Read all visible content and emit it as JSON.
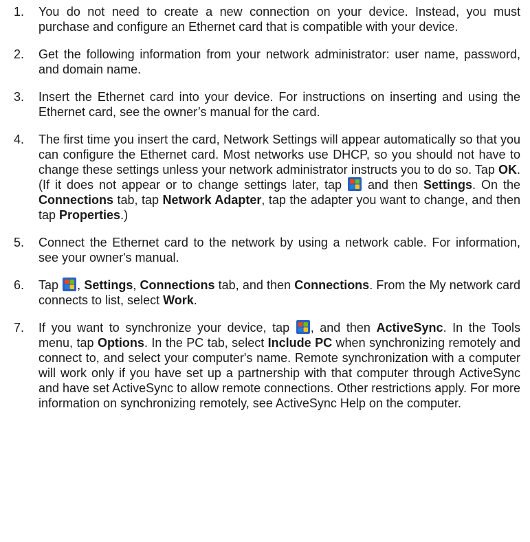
{
  "steps": [
    {
      "num": "1.",
      "parts": [
        {
          "t": "You do not need to create a new connection on your device. Instead, you must purchase and configure an Ethernet card that is compatible with your device."
        }
      ]
    },
    {
      "num": "2.",
      "parts": [
        {
          "t": "Get the following information from your network administrator: user name, password, and domain name."
        }
      ]
    },
    {
      "num": "3.",
      "parts": [
        {
          "t": "Insert the Ethernet card into your device. For instructions on inserting and using the Ethernet card, see the owner’s manual for the card."
        }
      ]
    },
    {
      "num": "4.",
      "parts": [
        {
          "t": "The first time you insert the card, Network Settings will appear automatically so that you can configure the Ethernet card. Most networks use DHCP, so you should not have to change these settings unless your network administrator instructs you to do so. Tap "
        },
        {
          "b": "OK"
        },
        {
          "t": ". (If it does not appear or to change settings later, tap "
        },
        {
          "icon": "windows-start-icon"
        },
        {
          "t": " and then "
        },
        {
          "b": "Settings"
        },
        {
          "t": ". On the "
        },
        {
          "b": "Connections"
        },
        {
          "t": " tab, tap "
        },
        {
          "b": "Network Adapter"
        },
        {
          "t": ", tap the adapter you want to change, and then tap "
        },
        {
          "b": "Properties"
        },
        {
          "t": ".)"
        }
      ]
    },
    {
      "num": "5.",
      "parts": [
        {
          "t": "Connect the Ethernet card to the network by using a network cable. For information, see your owner's manual."
        }
      ]
    },
    {
      "num": "6.",
      "parts": [
        {
          "t": "Tap "
        },
        {
          "icon": "windows-start-icon"
        },
        {
          "t": ", "
        },
        {
          "b": "Settings"
        },
        {
          "t": ", "
        },
        {
          "b": "Connections"
        },
        {
          "t": " tab, and then "
        },
        {
          "b": "Connections"
        },
        {
          "t": ". From the My network card connects to list, select "
        },
        {
          "b": "Work"
        },
        {
          "t": "."
        }
      ]
    },
    {
      "num": "7.",
      "parts": [
        {
          "t": "If you want to synchronize your device, tap "
        },
        {
          "icon": "windows-start-icon"
        },
        {
          "t": ", and then "
        },
        {
          "b": "ActiveSync"
        },
        {
          "t": ". In the Tools menu, tap "
        },
        {
          "b": "Options"
        },
        {
          "t": ". In the PC tab, select "
        },
        {
          "b": "Include PC"
        },
        {
          "t": " when synchronizing remotely and connect to, and select your computer's name. Remote synchronization with a computer will work only if you have set up a partnership with that computer through ActiveSync and have set ActiveSync to allow remote connections. Other restrictions apply. For more information on synchronizing remotely, see ActiveSync Help on the computer."
        }
      ]
    }
  ],
  "colors": {
    "text": "#1a1a1a",
    "icon_red": "#e8481c",
    "icon_green": "#6dbb1f",
    "icon_blue": "#1f7fd9",
    "icon_yellow": "#f5c21b",
    "icon_bg": "#2a5fc4"
  }
}
